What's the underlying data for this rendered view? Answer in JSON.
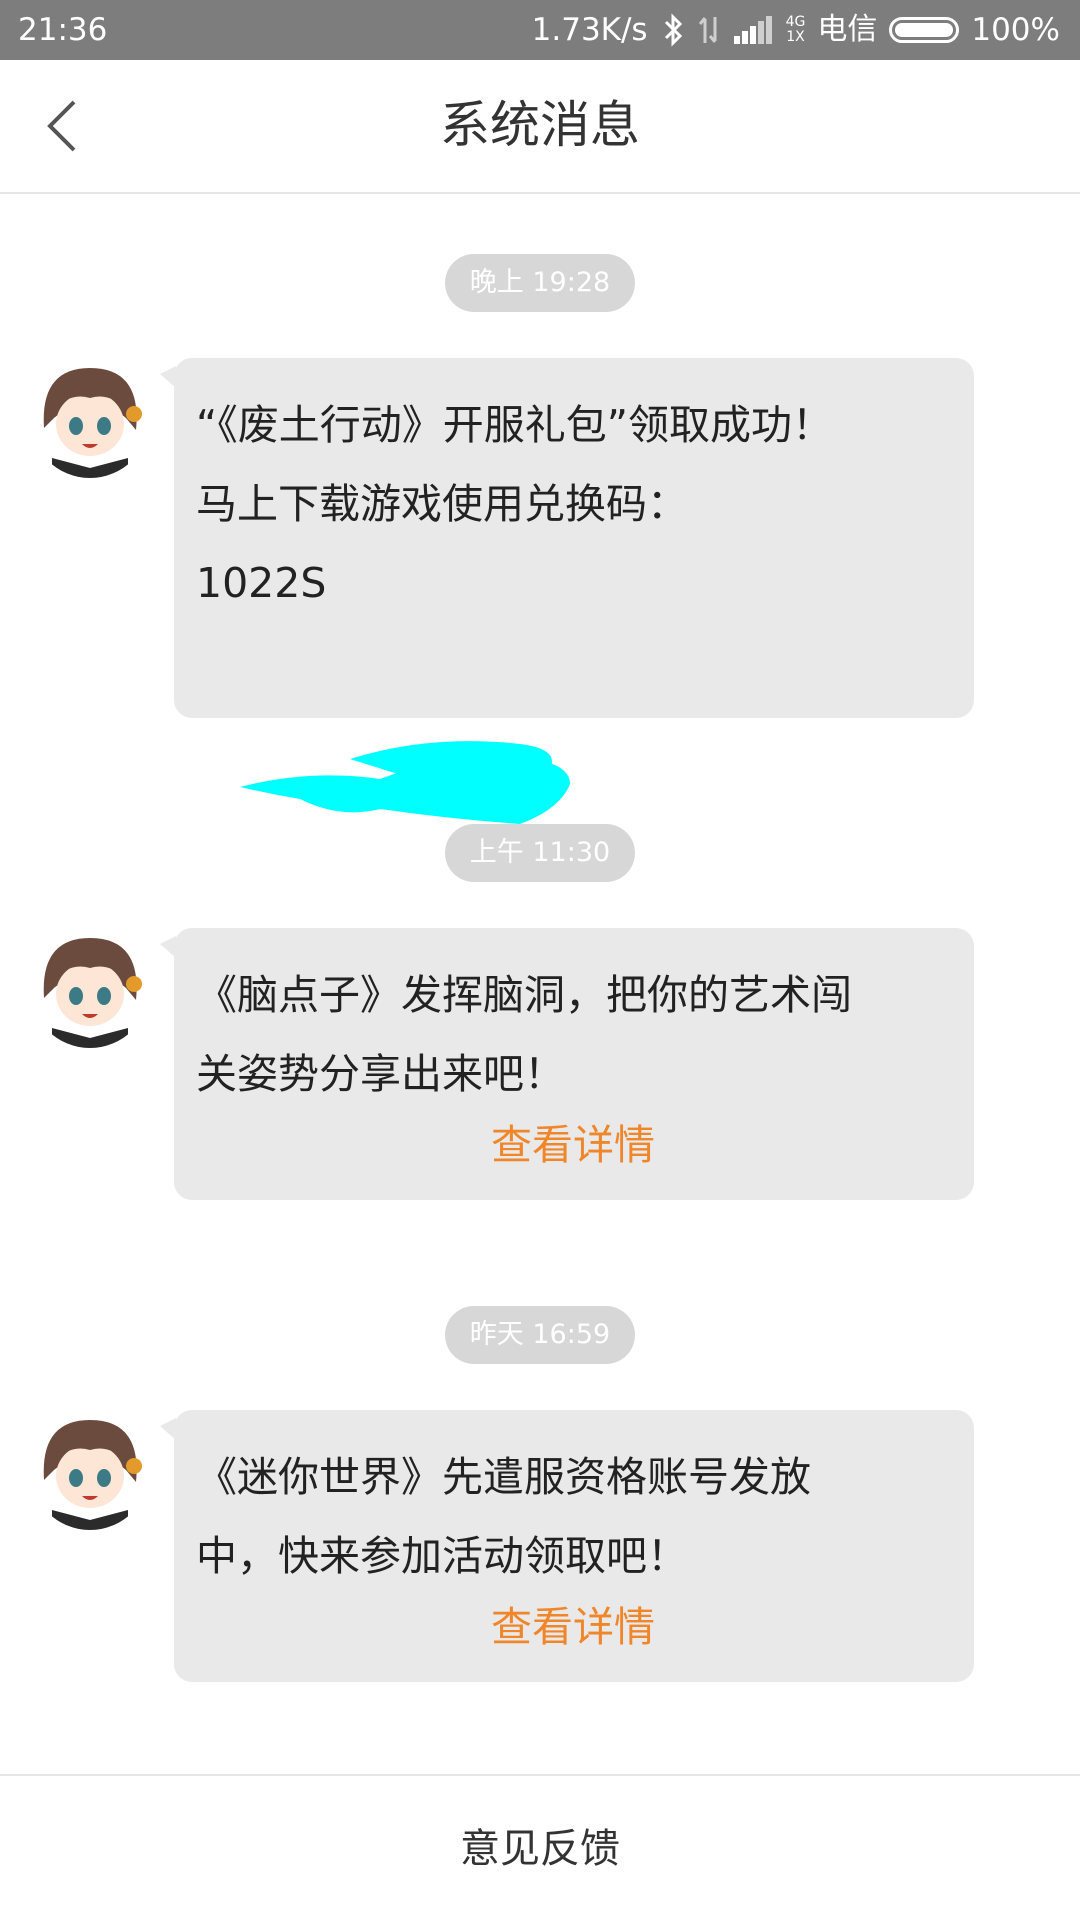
{
  "status_bar": {
    "time": "21:36",
    "net_speed": "1.73K/s",
    "tech_top": "4G",
    "tech_bottom": "1X",
    "carrier": "电信",
    "battery_pct": "100%",
    "icons": [
      "bluetooth-icon",
      "data-arrows-icon",
      "signal-icon",
      "battery-icon"
    ]
  },
  "header": {
    "title": "系统消息",
    "back_icon": "chevron-left-icon"
  },
  "messages": [
    {
      "timestamp": "晚上 19:28",
      "lines": [
        "“《废土行动》开服礼包”领取成功！",
        "马上下载游戏使用兑换码：",
        "1022S"
      ],
      "link": ""
    },
    {
      "timestamp": "上午 11:30",
      "lines": [
        "《脑点子》发挥脑洞，把你的艺术闯",
        "关姿势分享出来吧！"
      ],
      "link": "查看详情"
    },
    {
      "timestamp": "昨天 16:59",
      "lines": [
        "《迷你世界》先遣服资格账号发放",
        "中，快来参加活动领取吧！"
      ],
      "link": "查看详情"
    }
  ],
  "footer": {
    "feedback_label": "意见反馈"
  },
  "colors": {
    "status_bar_bg": "#7d7d7d",
    "bubble_bg": "#e9e9e9",
    "link": "#f0862a",
    "timestamp_pill": "#d7d7d7",
    "redaction": "#00ffff"
  }
}
